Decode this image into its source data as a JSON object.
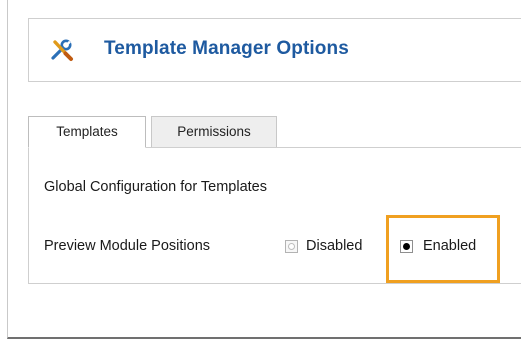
{
  "header": {
    "title": "Template Manager Options",
    "icon": "tools-icon"
  },
  "tabs": [
    {
      "label": "Templates",
      "active": true
    },
    {
      "label": "Permissions",
      "active": false
    }
  ],
  "panel": {
    "section_title": "Global Configuration for Templates",
    "option": {
      "label": "Preview Module Positions",
      "choices": [
        {
          "label": "Disabled",
          "selected": false
        },
        {
          "label": "Enabled",
          "selected": true
        }
      ]
    }
  },
  "colors": {
    "title": "#1e5aa0",
    "highlight": "#f0a020"
  }
}
